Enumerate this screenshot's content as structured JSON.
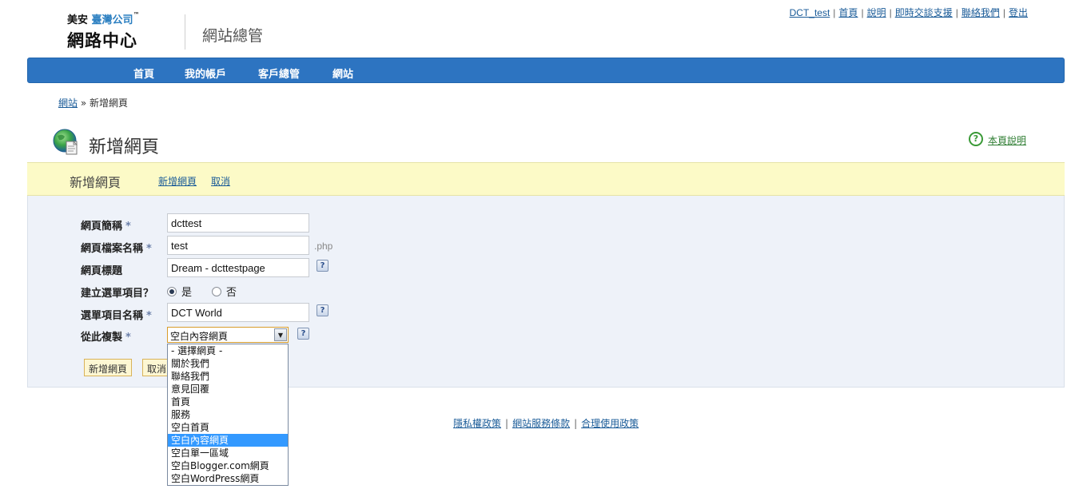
{
  "logo": {
    "top_prefix": "美安",
    "top_blue": "臺灣公司",
    "trademark": "™",
    "main": "網路中心"
  },
  "header": {
    "site_admin_title": "網站總管"
  },
  "top_links": [
    {
      "label": "DCT_test"
    },
    {
      "label": "首頁"
    },
    {
      "label": "說明"
    },
    {
      "label": "即時交談支援"
    },
    {
      "label": "聯絡我們"
    },
    {
      "label": "登出"
    }
  ],
  "top_links_separator": "|",
  "nav": {
    "items": [
      "首頁",
      "我的帳戶",
      "客戶總管",
      "網站"
    ]
  },
  "breadcrumb": {
    "link": "網站",
    "separator": "»",
    "current": "新增網頁"
  },
  "page": {
    "title": "新增網頁",
    "help_icon": "?",
    "help_link": "本頁說明"
  },
  "action_bar": {
    "title": "新增網頁",
    "links": [
      "新增網頁",
      "取消"
    ]
  },
  "form": {
    "required_mark": "*",
    "help_mark": "?",
    "page_name": {
      "label": "網頁簡稱",
      "value": "dcttest"
    },
    "file_name": {
      "label": "網頁檔案名稱",
      "value": "test",
      "suffix": ".php"
    },
    "page_title": {
      "label": "網頁標題",
      "value": "Dream - dcttestpage"
    },
    "create_menu": {
      "label": "建立選單項目？",
      "options": [
        "是",
        "否"
      ],
      "selected": "是"
    },
    "menu_item_name": {
      "label": "選單項目名稱",
      "value": "DCT World"
    },
    "copy_from": {
      "label": "從此複製",
      "selected": "空白內容網頁",
      "options": [
        "- 選擇網頁 -",
        "關於我們",
        "聯絡我們",
        "意見回覆",
        "首頁",
        "服務",
        "空白首頁",
        "空白內容網頁",
        "空白單一區域",
        "空白Blogger.com網頁",
        "空白WordPress網頁"
      ]
    },
    "submit_label": "新增網頁",
    "cancel_label": "取消"
  },
  "footer": {
    "links": [
      "隱私權政策",
      "網站服務條款",
      "合理使用政策"
    ],
    "separator": "|"
  },
  "colors": {
    "nav_bg": "#2d74c1",
    "action_bar_bg": "#fcfac7",
    "form_bg": "#eef2f9",
    "link": "#1a5b98",
    "selected_option": "#3399ff"
  }
}
